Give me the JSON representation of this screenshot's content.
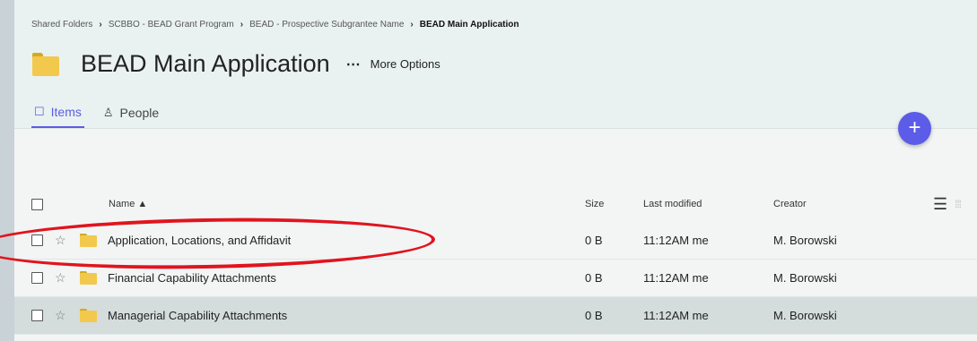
{
  "breadcrumb": [
    "Shared Folders",
    "SCBBO - BEAD Grant Program",
    "BEAD - Prospective Subgrantee Name",
    "BEAD Main Application"
  ],
  "breadcrumb_separator": "›",
  "header": {
    "title": "BEAD Main Application",
    "more_icon": "⋯",
    "more_label": "More Options",
    "folder_icon": "folder-icon"
  },
  "tabs": [
    {
      "label": "Items",
      "icon": "☐",
      "active": true
    },
    {
      "label": "People",
      "icon": "♙",
      "active": false
    }
  ],
  "fab": {
    "icon": "+"
  },
  "table": {
    "columns": {
      "name": "Name ▲",
      "size": "Size",
      "modified": "Last modified",
      "creator": "Creator"
    },
    "view_icons": {
      "list": "☰",
      "grid": "⁞⁞⁞"
    },
    "rows": [
      {
        "name": "Application, Locations, and Affidavit",
        "size": "0 B",
        "modified": "11:12AM me",
        "creator": "M. Borowski",
        "highlighted": true
      },
      {
        "name": "Financial Capability Attachments",
        "size": "0 B",
        "modified": "11:12AM me",
        "creator": "M. Borowski"
      },
      {
        "name": "Managerial Capability Attachments",
        "size": "0 B",
        "modified": "11:12AM me",
        "creator": "M. Borowski",
        "selected": true
      }
    ],
    "star_icon": "☆"
  },
  "colors": {
    "accent": "#5b5be6",
    "folder": "#f2c94c",
    "highlight": "#e1141e",
    "selected_row": "#d4dcdc"
  }
}
